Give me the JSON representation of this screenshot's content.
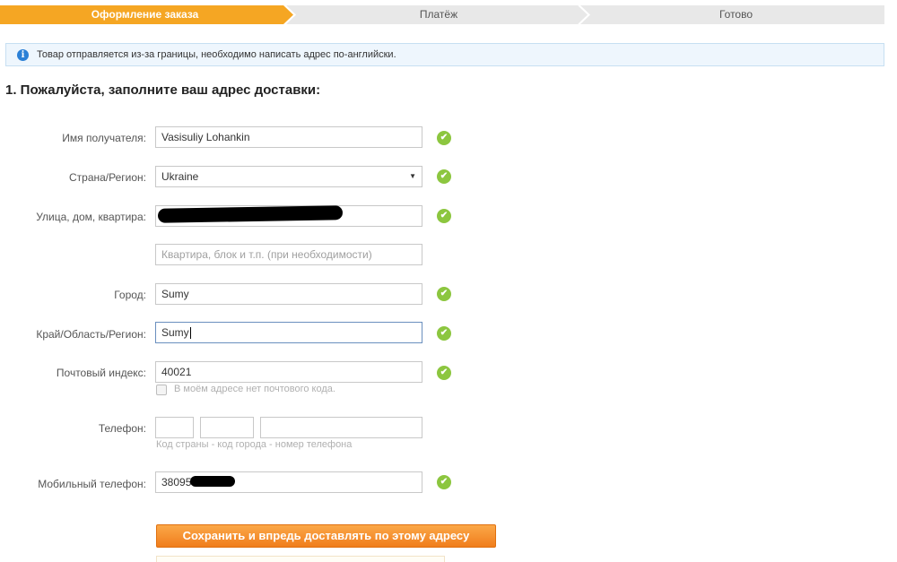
{
  "steps": [
    {
      "label": "Оформление заказа",
      "active": true
    },
    {
      "label": "Платёж",
      "active": false
    },
    {
      "label": "Готово",
      "active": false
    }
  ],
  "colors": {
    "active_step": "#f5a623",
    "inactive_step": "#e8e8e8",
    "check": "#8cc63f",
    "button": "#f28c28",
    "info": "#2b80d6"
  },
  "notice": {
    "icon": "info-icon",
    "text": "Товар отправляется из-за границы, необходимо написать адрес по-английски."
  },
  "section_title": "1. Пожалуйста, заполните ваш адрес доставки:",
  "form": {
    "recipient": {
      "label": "Имя получателя:",
      "value": "Vasisuliy Lohankin"
    },
    "country": {
      "label": "Страна/Регион:",
      "value": "Ukraine"
    },
    "street": {
      "label": "Улица, дом, квартира:",
      "value": ""
    },
    "apartment": {
      "placeholder": "Квартира, блок и т.п. (при необходимости)"
    },
    "city": {
      "label": "Город:",
      "value": "Sumy"
    },
    "region": {
      "label": "Край/Область/Регион:",
      "value": "Sumy"
    },
    "zip": {
      "label": "Почтовый индекс:",
      "value": "40021",
      "no_zip_label": "В моём адресе нет почтового кода."
    },
    "phone": {
      "label": "Телефон:",
      "hint": "Код страны - код города - номер телефона"
    },
    "mobile": {
      "label": "Мобильный телефон:",
      "value": "38095"
    }
  },
  "save_button": "Сохранить и впредь доставлять по этому адресу"
}
